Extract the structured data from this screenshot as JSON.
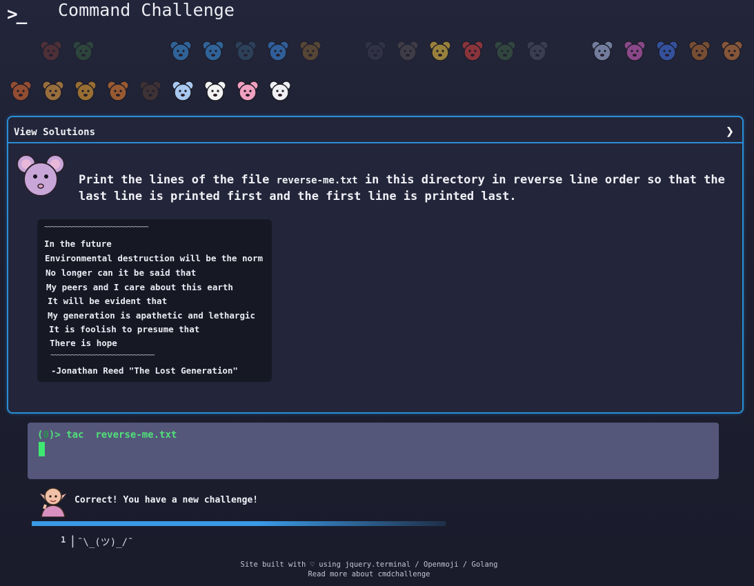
{
  "header": {
    "logo_text": ">_",
    "title": "Command Challenge"
  },
  "emoji_row_1": [
    {
      "name": "shrimp-icon",
      "state": "dim",
      "color": "#c0503a"
    },
    {
      "name": "snail-icon",
      "state": "dim",
      "color": "#4a9a4a"
    },
    {
      "name": "spacer",
      "state": "none",
      "color": ""
    },
    {
      "name": "spacer",
      "state": "none",
      "color": ""
    },
    {
      "name": "whale-icon",
      "state": "mid",
      "color": "#3a8ed8"
    },
    {
      "name": "dolphin-icon",
      "state": "mid",
      "color": "#3a8ed8"
    },
    {
      "name": "shark-icon",
      "state": "dim",
      "color": "#4a8ab0"
    },
    {
      "name": "fish-icon",
      "state": "mid",
      "color": "#3a86d8"
    },
    {
      "name": "tropical-fish-icon",
      "state": "dim",
      "color": "#e0a030"
    },
    {
      "name": "spacer",
      "state": "none",
      "color": ""
    },
    {
      "name": "spider-icon",
      "state": "dim",
      "color": "#555566"
    },
    {
      "name": "bat-icon",
      "state": "dim",
      "color": "#8a7a70"
    },
    {
      "name": "bee-icon",
      "state": "mid",
      "color": "#e8c040"
    },
    {
      "name": "ladybug-icon",
      "state": "mid",
      "color": "#d04040"
    },
    {
      "name": "cricket-icon",
      "state": "dim",
      "color": "#5aa050"
    },
    {
      "name": "mosquito-icon",
      "state": "dim",
      "color": "#7a7a90"
    },
    {
      "name": "spacer",
      "state": "none",
      "color": ""
    },
    {
      "name": "lungs-icon",
      "state": "mid",
      "color": "#a8b8e0"
    },
    {
      "name": "worm-icon",
      "state": "mid",
      "color": "#d060c0"
    },
    {
      "name": "microbe-icon",
      "state": "mid",
      "color": "#4070e0"
    },
    {
      "name": "monkey-face-icon",
      "state": "mid",
      "color": "#b06a30"
    },
    {
      "name": "dog-face-icon",
      "state": "mid",
      "color": "#c8783a"
    }
  ],
  "emoji_row_2": [
    {
      "name": "fox-face-icon",
      "state": "mid",
      "color": "#e06a30"
    },
    {
      "name": "cat-face-icon",
      "state": "mid",
      "color": "#e8a040"
    },
    {
      "name": "lion-face-icon",
      "state": "mid",
      "color": "#e8a030"
    },
    {
      "name": "tiger-face-icon",
      "state": "mid",
      "color": "#e88030"
    },
    {
      "name": "deer-icon",
      "state": "dim",
      "color": "#8a5a30"
    },
    {
      "name": "unicorn-icon",
      "state": "full",
      "color": "#a8c8f0"
    },
    {
      "name": "cow-face-icon",
      "state": "full",
      "color": "#f2f2f2"
    },
    {
      "name": "pig-face-icon",
      "state": "full",
      "color": "#f0a0c0"
    },
    {
      "name": "mouse-face-icon",
      "state": "full",
      "color": "#f0f0f4"
    }
  ],
  "panel": {
    "view_solutions_label": "View Solutions",
    "chevron": "❯",
    "prompt_before": "Print the lines of the file ",
    "prompt_file": "reverse-me.txt",
    "prompt_after": " in this directory in reverse line order so that the",
    "prompt_line2": "last line is printed first and the first line is printed last.",
    "poem": {
      "tilde_top": "~~~~~~~~~~~~~~~~~~~~~~~~~~~~~~",
      "lines": [
        "In the future",
        "Environmental destruction will be the norm",
        "No longer can it be said that",
        "My peers and I care about this earth",
        "It will be evident that",
        "My generation is apathetic and lethargic",
        "It is foolish to presume that",
        "There is hope"
      ],
      "tilde_bottom": "~~~~~~~~~~~~~~~~~~~~~~~~~~~~~~",
      "attribution": "-Jonathan Reed \"The Lost Generation\""
    }
  },
  "terminal": {
    "prompt_prefix": "(",
    "prompt_zero": "0",
    "prompt_suffix": ")> ",
    "command": "tac  reverse-me.txt"
  },
  "result": {
    "message": "Correct! You have a new challenge!",
    "progress_fraction": 0.55
  },
  "level": {
    "number": "1",
    "separator": "|",
    "shrug": "¯\\_(ツ)_/¯"
  },
  "footer": {
    "line1": "Site built with ♡ using jquery.terminal / Openmoji / Golang",
    "line2": "Read more about cmdchallenge"
  }
}
